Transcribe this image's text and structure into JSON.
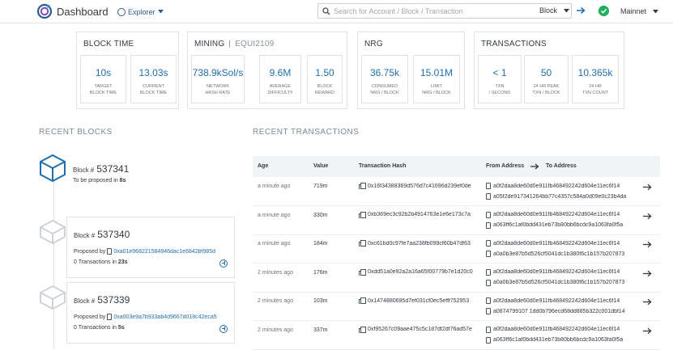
{
  "header": {
    "app_title": "Dashboard",
    "explorer_label": "Explorer",
    "search_placeholder": "Search for Account / Block / Transaction",
    "search_type": "Block",
    "network": "Mainnet",
    "accent_color": "#1f6fae",
    "status_color": "#1fae5e"
  },
  "stats": {
    "block_time": {
      "title": "BLOCK TIME",
      "metrics": [
        {
          "value": "10s",
          "label1": "TARGET",
          "label2": "BLOCK TIME"
        },
        {
          "value": "13.03s",
          "label1": "CURRENT",
          "label2": "BLOCK TIME"
        }
      ]
    },
    "mining": {
      "title": "MINING",
      "subtitle": "EQUI2109",
      "metrics": [
        {
          "value": "738.9kSol/s",
          "label1": "NETWORK",
          "label2": "HASH RATE"
        },
        {
          "value": "9.6M",
          "label1": "AVERAGE",
          "label2": "DIFFICULTY"
        },
        {
          "value": "1.50",
          "label1": "BLOCK",
          "label2": "REWARD"
        }
      ]
    },
    "nrg": {
      "title": "NRG",
      "metrics": [
        {
          "value": "36.75k",
          "label1": "CONSUMED",
          "label2": "NRG / BLOCK"
        },
        {
          "value": "15.01M",
          "label1": "LIMIT",
          "label2": "NRG / BLOCK"
        }
      ]
    },
    "transactions": {
      "title": "TRANSACTIONS",
      "metrics": [
        {
          "value": "< 1",
          "label1": "TXN",
          "label2": "/ SECOND"
        },
        {
          "value": "50",
          "label1": "24 HR PEAK",
          "label2": "TXN / BLOCK"
        },
        {
          "value": "10.365k",
          "label1": "24 HR",
          "label2": "TXN COUNT"
        }
      ]
    }
  },
  "recent_blocks": {
    "title": "RECENT BLOCKS",
    "pending": {
      "label": "Block #",
      "number": "537341",
      "status_prefix": "To be proposed in",
      "status_value": "8s"
    },
    "items": [
      {
        "label": "Block #",
        "number": "537340",
        "proposer_label": "Proposed by",
        "proposer": "0xa01e968221584946dac1e6842bf985d",
        "tx_text": "0 Transactions in",
        "tx_time": "23s"
      },
      {
        "label": "Block #",
        "number": "537339",
        "proposer_label": "Proposed by",
        "proposer": "0xa003e9a7b933ab4d9667d018c42eca5",
        "tx_text": "0 Transactions in",
        "tx_time": "5s"
      }
    ]
  },
  "recent_transactions": {
    "title": "RECENT TRANSACTIONS",
    "columns": {
      "age": "Age",
      "value": "Value",
      "hash": "Transaction Hash",
      "from": "From Address",
      "to": "To Address"
    },
    "rows": [
      {
        "age": "a minute ago",
        "value": "719m",
        "hash": "0x16f34388369d576d7c41696d239ef0de",
        "from": "a0f2daa8de60d0e911fb468492242d604e11ec6f14",
        "to": "a05f2de917341264bb77c4357c584a0d09e0c23b4da"
      },
      {
        "age": "a minute ago",
        "value": "330m",
        "hash": "0xb369ec3c92b2b4914763e1e6e173c7a",
        "from": "a0f2daa8de60d0e911fb468492242d604e11ec6f14",
        "to": "a063ff6c1af0bdd431eb73b80bb6bcdc9a1063fa0f5a"
      },
      {
        "age": "a minute ago",
        "value": "184m",
        "hash": "0xc61bd0c97fe7aa238fb099cf60b47df63",
        "from": "a0f2daa8de60d0e911fb468492242d604e11ec6f14",
        "to": "a0a0b3e87b5d526cf5041dc1b380f6c1b157b207873"
      },
      {
        "age": "2 minutes ago",
        "value": "176m",
        "hash": "0xdd51a0e92a2a16a65f00779b7e1d20c0",
        "from": "a0f2daa8de60d0e911fb468492242d604e11ec6f14",
        "to": "a0a0b3e87b5d526cf5041dc1b380f6c1b157b207873"
      },
      {
        "age": "2 minutes ago",
        "value": "103m",
        "hash": "0x1474880695d7ef031cf0ec5efff752953",
        "from": "a0f2daa8de60d0e911fb468492242d604e11ec6f14",
        "to": "a0874799107 1dd0b796ecd68dd885b322c001dbf14"
      },
      {
        "age": "2 minutes ago",
        "value": "337m",
        "hash": "0xf95267c09aae475c5c187df2df76ad57e",
        "from": "a0f2daa8de60d0e911fb468492242d604e11ec6f14",
        "to": "a063ff6c1af0bdd431eb73b80bb6bcdc9a1063fa0f5a"
      }
    ]
  }
}
